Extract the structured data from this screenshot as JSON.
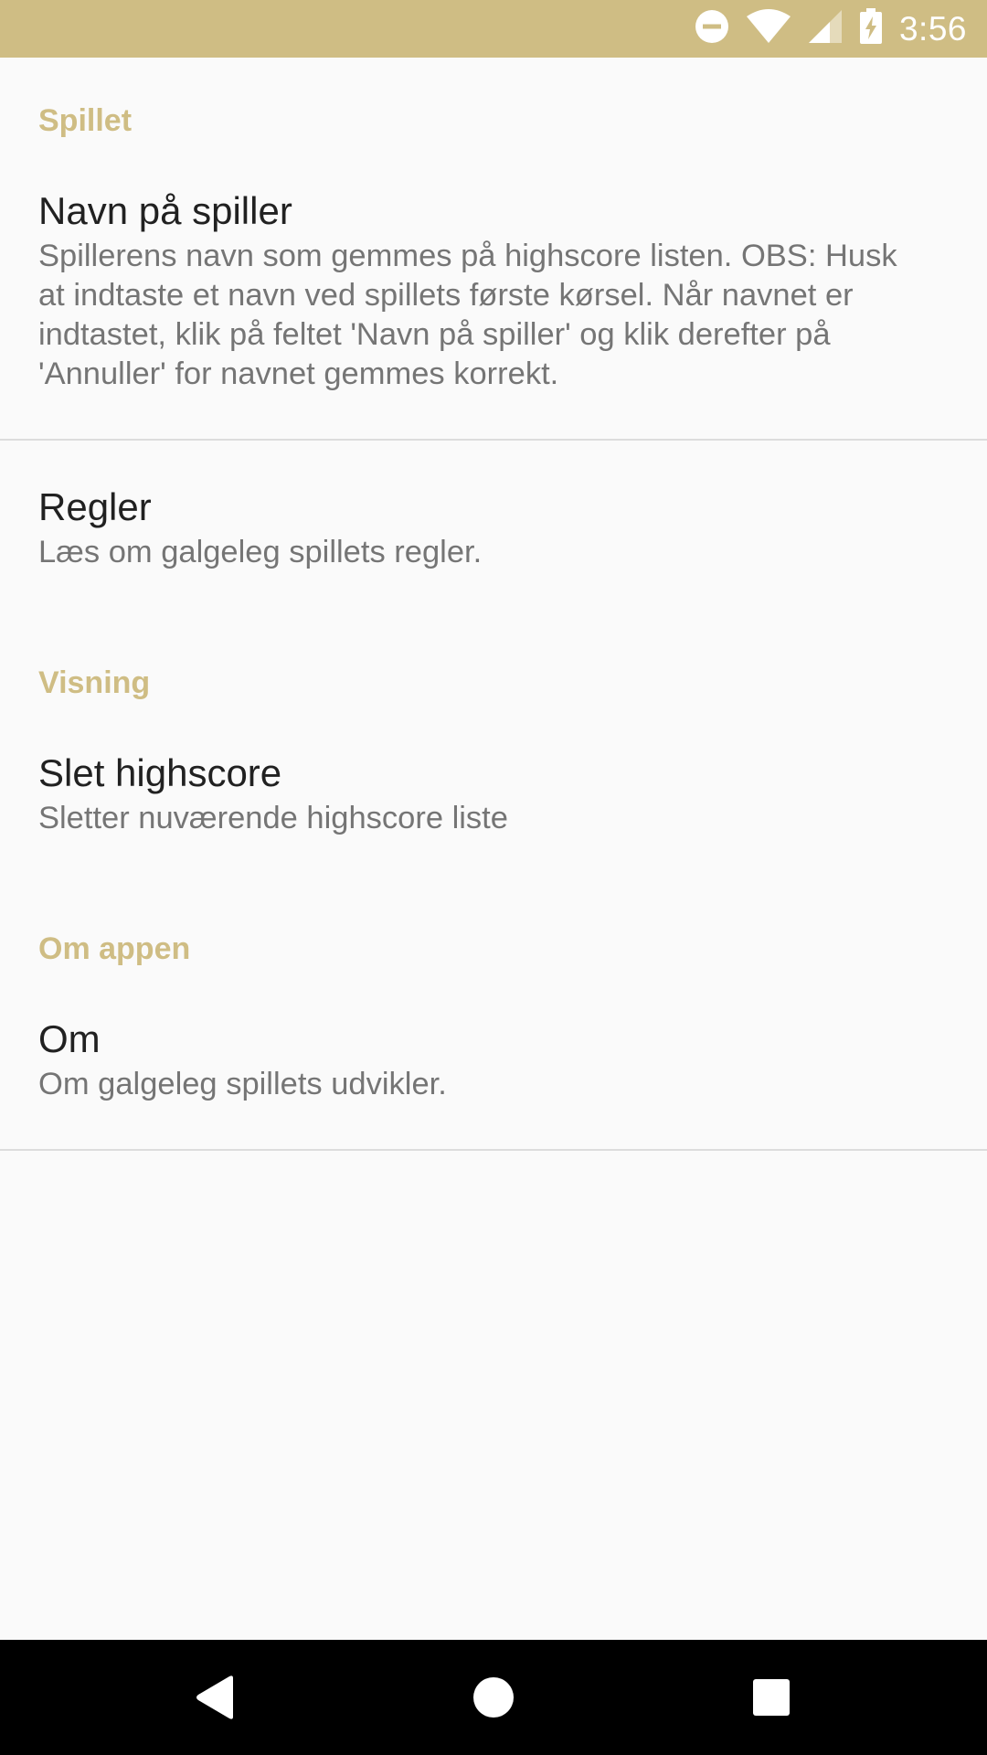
{
  "status_bar": {
    "time": "3:56",
    "icons": [
      "do-not-disturb-icon",
      "wifi-icon",
      "signal-icon",
      "battery-charging-icon"
    ],
    "background": "#cfbd84"
  },
  "settings": {
    "categories": [
      {
        "label": "Spillet",
        "items": [
          {
            "title": "Navn på spiller",
            "summary_lines": [
              "Spillerens navn som gemmes på highscore listen. OBS: Husk",
              "at indtaste et navn ved spillets første kørsel. Når navnet er",
              "indtastet, klik på feltet 'Navn på spiller' og klik derefter på",
              "'Annuller' for navnet gemmes korrekt."
            ]
          },
          {
            "title": "Regler",
            "summary": "Læs om galgeleg spillets regler."
          }
        ]
      },
      {
        "label": "Visning",
        "items": [
          {
            "title": "Slet highscore",
            "summary": "Sletter nuværende highscore liste"
          }
        ]
      },
      {
        "label": "Om appen",
        "items": [
          {
            "title": "Om",
            "summary": "Om galgeleg spillets udvikler."
          }
        ]
      }
    ]
  },
  "nav_bar": {
    "buttons": [
      "back-icon",
      "home-icon",
      "recents-icon"
    ]
  },
  "colors": {
    "accent": "#cfbd84",
    "title_text": "#212121",
    "summary_text": "#757575",
    "divider": "#dcdcdc"
  }
}
